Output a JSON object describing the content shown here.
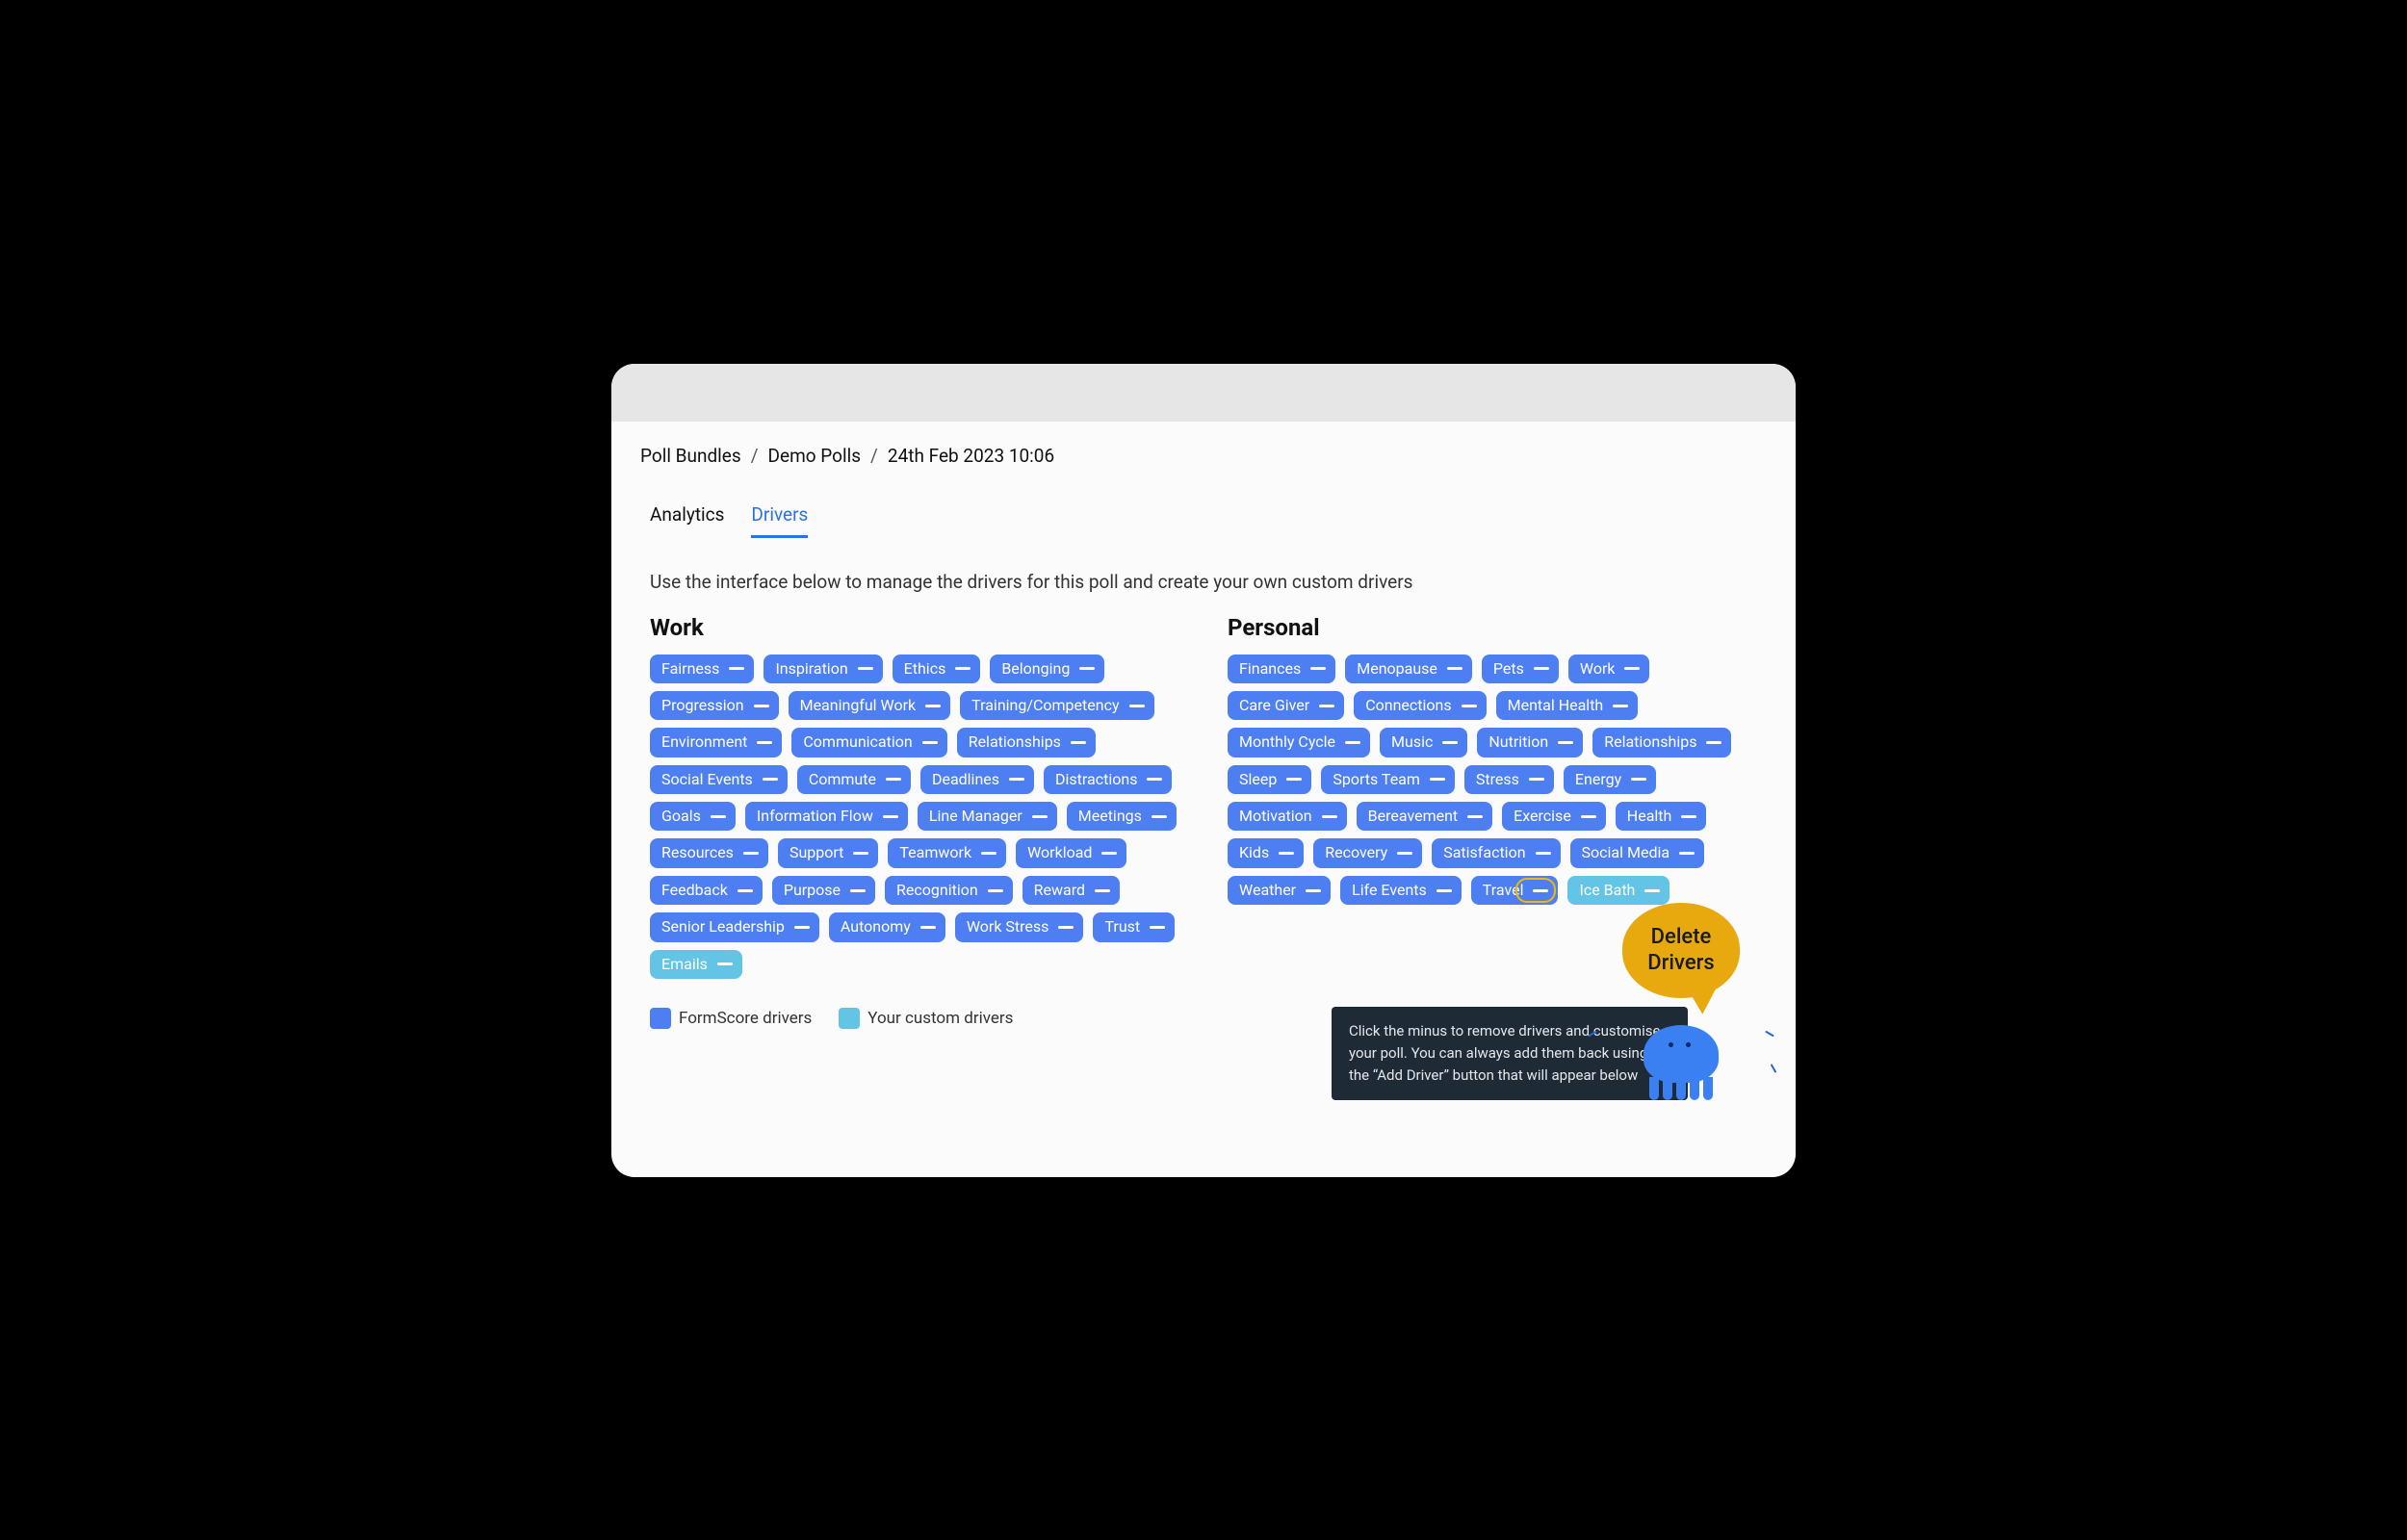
{
  "breadcrumb": {
    "items": [
      "Poll Bundles",
      "Demo Polls",
      "24th Feb 2023 10:06"
    ],
    "sep": "/"
  },
  "tabs": [
    {
      "label": "Analytics",
      "active": false
    },
    {
      "label": "Drivers",
      "active": true
    }
  ],
  "intro": "Use the interface below to manage the drivers for this poll and create your own custom drivers",
  "columns": {
    "work": {
      "title": "Work",
      "pills": [
        {
          "label": "Fairness"
        },
        {
          "label": "Inspiration"
        },
        {
          "label": "Ethics"
        },
        {
          "label": "Belonging"
        },
        {
          "label": "Progression"
        },
        {
          "label": "Meaningful Work"
        },
        {
          "label": "Training/Competency"
        },
        {
          "label": "Environment"
        },
        {
          "label": "Communication"
        },
        {
          "label": "Relationships"
        },
        {
          "label": "Social Events"
        },
        {
          "label": "Commute"
        },
        {
          "label": "Deadlines"
        },
        {
          "label": "Distractions"
        },
        {
          "label": "Goals"
        },
        {
          "label": "Information Flow"
        },
        {
          "label": "Line Manager"
        },
        {
          "label": "Meetings"
        },
        {
          "label": "Resources"
        },
        {
          "label": "Support"
        },
        {
          "label": "Teamwork"
        },
        {
          "label": "Workload"
        },
        {
          "label": "Feedback"
        },
        {
          "label": "Purpose"
        },
        {
          "label": "Recognition"
        },
        {
          "label": "Reward"
        },
        {
          "label": "Senior Leadership"
        },
        {
          "label": "Autonomy"
        },
        {
          "label": "Work Stress"
        },
        {
          "label": "Trust"
        },
        {
          "label": "Emails",
          "custom": true
        }
      ]
    },
    "personal": {
      "title": "Personal",
      "pills": [
        {
          "label": "Finances"
        },
        {
          "label": "Menopause"
        },
        {
          "label": "Pets"
        },
        {
          "label": "Work"
        },
        {
          "label": "Care Giver"
        },
        {
          "label": "Connections"
        },
        {
          "label": "Mental Health"
        },
        {
          "label": "Monthly Cycle"
        },
        {
          "label": "Music"
        },
        {
          "label": "Nutrition"
        },
        {
          "label": "Relationships"
        },
        {
          "label": "Sleep"
        },
        {
          "label": "Sports Team"
        },
        {
          "label": "Stress"
        },
        {
          "label": "Energy"
        },
        {
          "label": "Motivation"
        },
        {
          "label": "Bereavement"
        },
        {
          "label": "Exercise"
        },
        {
          "label": "Health"
        },
        {
          "label": "Kids"
        },
        {
          "label": "Recovery"
        },
        {
          "label": "Satisfaction"
        },
        {
          "label": "Social Media"
        },
        {
          "label": "Weather"
        },
        {
          "label": "Life Events"
        },
        {
          "label": "Travel",
          "highlight": true
        },
        {
          "label": "Ice Bath",
          "custom": true
        }
      ]
    }
  },
  "legend": {
    "formscore": "FormScore drivers",
    "custom": "Your custom drivers"
  },
  "tooltip": "Click the minus to remove drivers and customise your poll. You can always add them back using the “Add Driver” button that will appear below",
  "callout": {
    "line1": "Delete",
    "line2": "Drivers"
  },
  "colors": {
    "pill_default": "#4d7ff2",
    "pill_custom": "#63c4e6",
    "accent": "#2a72e8",
    "callout_bg": "#e8a90f"
  }
}
